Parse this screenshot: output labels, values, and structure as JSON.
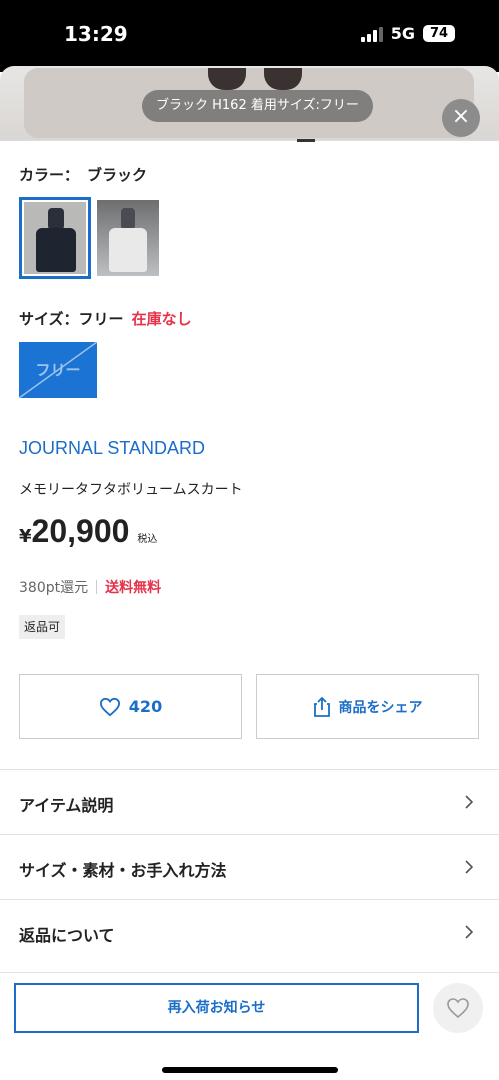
{
  "status_bar": {
    "time": "13:29",
    "network": "5G",
    "battery": "74"
  },
  "image_caption": "ブラック H162 着用サイズ:フリー",
  "close_symbol": "×",
  "color": {
    "label": "カラー：",
    "selected": "ブラック",
    "swatches": [
      "black",
      "white"
    ]
  },
  "size": {
    "label": "サイズ：フリー",
    "stock_status": "在庫なし",
    "chip_label": "フリー"
  },
  "product": {
    "brand": "JOURNAL STANDARD",
    "name": "メモリータフタボリュームスカート",
    "currency": "¥",
    "price": "20,900",
    "tax_note": "税込",
    "points": "380pt還元",
    "shipping": "送料無料",
    "return_badge": "返品可"
  },
  "actions": {
    "like_count": "420",
    "share_label": "商品をシェア"
  },
  "accordion": [
    "アイテム説明",
    "サイズ・素材・お手入れ方法",
    "返品について"
  ],
  "bottom": {
    "restock_label": "再入荷お知らせ"
  },
  "colors": {
    "accent_blue": "#1a6ec8",
    "alert_red": "#e5334b"
  }
}
